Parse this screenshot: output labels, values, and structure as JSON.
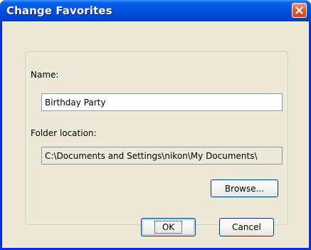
{
  "window": {
    "title": "Change Favorites",
    "close_symbol": "×"
  },
  "form": {
    "name_label": "Name:",
    "name_value": "Birthday Party",
    "folder_label": "Folder location:",
    "folder_value": "C:\\Documents and Settings\\nikon\\My Documents\\"
  },
  "buttons": {
    "browse": "Browse...",
    "ok": "OK",
    "cancel": "Cancel"
  },
  "icons": {
    "close": "close-icon"
  },
  "colors": {
    "titlebar": "#0a5fe8",
    "dialog_bg": "#ece9d8",
    "close_button": "#e5582f",
    "field_border": "#7f9db9"
  }
}
